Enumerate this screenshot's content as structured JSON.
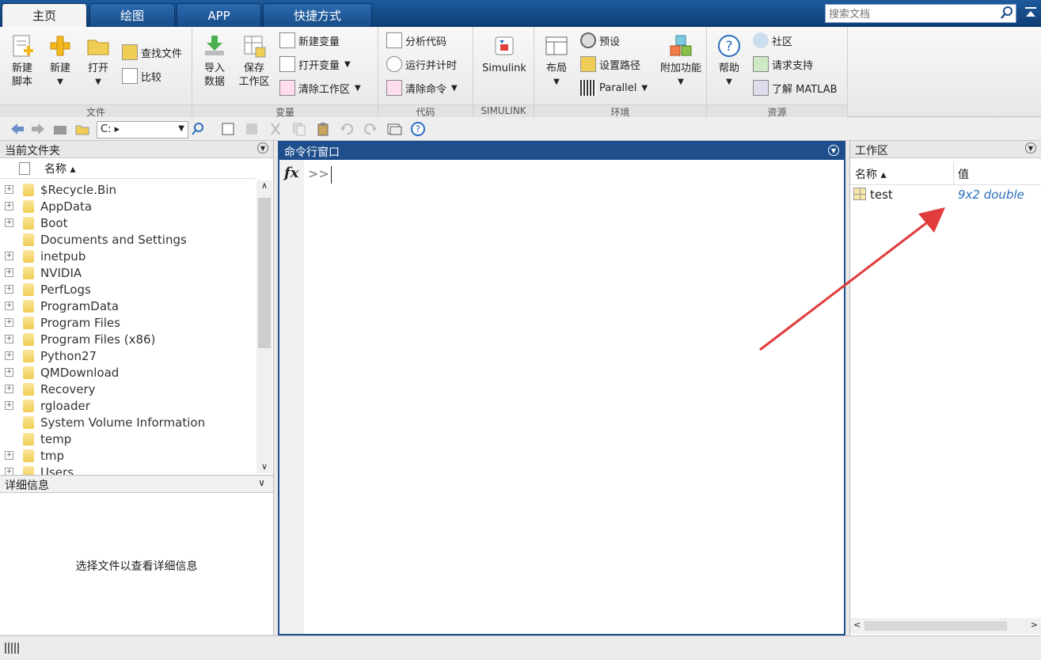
{
  "tabs": [
    {
      "label": "主页"
    },
    {
      "label": "绘图"
    },
    {
      "label": "APP"
    },
    {
      "label": "快捷方式"
    }
  ],
  "search": {
    "placeholder": "搜索文档"
  },
  "ribbon": {
    "file": {
      "label": "文件",
      "new_script": "新建\n脚本",
      "new": "新建",
      "open": "打开",
      "find_files": "查找文件",
      "compare": "比较"
    },
    "variable": {
      "label": "变量",
      "import": "导入\n数据",
      "save_ws": "保存\n工作区",
      "new_var": "新建变量",
      "open_var": "打开变量",
      "clear_ws": "清除工作区"
    },
    "code": {
      "label": "代码",
      "analyze": "分析代码",
      "run_time": "运行并计时",
      "clear_cmd": "清除命令"
    },
    "simulink": {
      "label": "SIMULINK",
      "simulink": "Simulink"
    },
    "env": {
      "label": "环境",
      "layout": "布局",
      "prefs": "预设",
      "set_path": "设置路径",
      "parallel": "Parallel",
      "addons": "附加功能"
    },
    "resources": {
      "label": "资源",
      "help": "帮助",
      "community": "社区",
      "support": "请求支持",
      "learn": "了解 MATLAB"
    }
  },
  "address": {
    "path": "C: ▸"
  },
  "current_folder": {
    "title": "当前文件夹",
    "col_name": "名称 ▴",
    "items": [
      {
        "name": "$Recycle.Bin",
        "exp": true
      },
      {
        "name": "AppData",
        "exp": true
      },
      {
        "name": "Boot",
        "exp": true
      },
      {
        "name": "Documents and Settings",
        "exp": false
      },
      {
        "name": "inetpub",
        "exp": true
      },
      {
        "name": "NVIDIA",
        "exp": true
      },
      {
        "name": "PerfLogs",
        "exp": true
      },
      {
        "name": "ProgramData",
        "exp": true
      },
      {
        "name": "Program Files",
        "exp": true
      },
      {
        "name": "Program Files (x86)",
        "exp": true
      },
      {
        "name": "Python27",
        "exp": true
      },
      {
        "name": "QMDownload",
        "exp": true
      },
      {
        "name": "Recovery",
        "exp": true
      },
      {
        "name": "rgloader",
        "exp": true
      },
      {
        "name": "System Volume Information",
        "exp": false
      },
      {
        "name": "temp",
        "exp": false
      },
      {
        "name": "tmp",
        "exp": true
      },
      {
        "name": "Users",
        "exp": true
      }
    ]
  },
  "details": {
    "title": "详细信息",
    "placeholder": "选择文件以查看详细信息"
  },
  "command_window": {
    "title": "命令行窗口",
    "fx": "fx",
    "prompt": ">>"
  },
  "workspace": {
    "title": "工作区",
    "col_name": "名称 ▴",
    "col_value": "值",
    "vars": [
      {
        "name": "test",
        "value": "9x2 double"
      }
    ]
  },
  "colors": {
    "accent": "#1e4f8c",
    "annotation": "#e03c3c",
    "value_text": "#2a6ebb"
  }
}
